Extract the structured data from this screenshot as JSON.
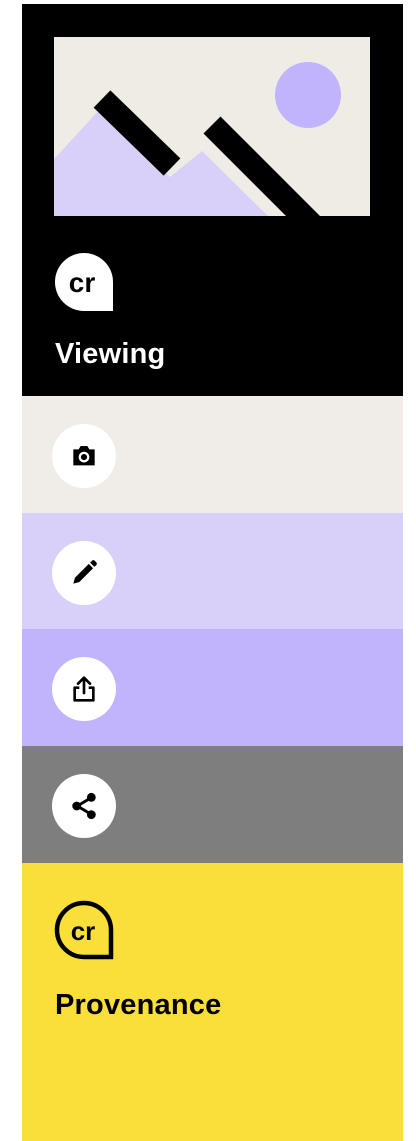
{
  "viewing_card": {
    "label": "Viewing",
    "illustration_icon": "image-placeholder-icon",
    "logo_text": "cr",
    "colors": {
      "background": "#000000",
      "image_bg": "#efece6",
      "mountain": "#d9d0f9",
      "sun": "#c2b3fd"
    }
  },
  "steps": [
    {
      "icon": "camera-icon",
      "background": "#f0ede8"
    },
    {
      "icon": "pencil-icon",
      "background": "#d9d0f9"
    },
    {
      "icon": "upload-icon",
      "background": "#c2b3fd"
    },
    {
      "icon": "share-icon",
      "background": "#7e7e7e"
    }
  ],
  "provenance_card": {
    "label": "Provenance",
    "logo_text": "cr",
    "background": "#fade3a"
  }
}
